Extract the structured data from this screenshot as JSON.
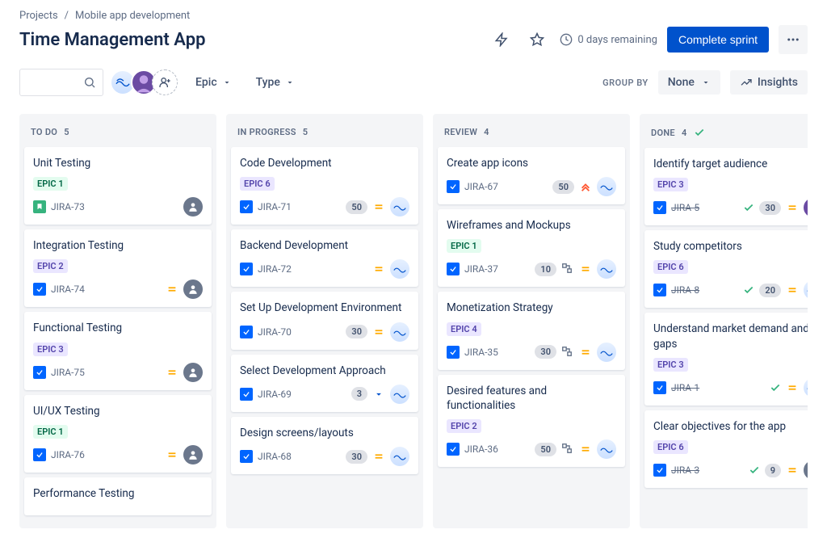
{
  "breadcrumb": {
    "projects": "Projects",
    "project": "Mobile app development"
  },
  "page_title": "Time Management App",
  "header": {
    "days_remaining": "0 days remaining",
    "complete_sprint": "Complete sprint"
  },
  "toolbar": {
    "epic_filter": "Epic",
    "type_filter": "Type",
    "group_by_label": "GROUP BY",
    "group_by_value": "None",
    "insights": "Insights"
  },
  "columns": [
    {
      "name": "TO DO",
      "count": "5"
    },
    {
      "name": "IN PROGRESS",
      "count": "5"
    },
    {
      "name": "REVIEW",
      "count": "4"
    },
    {
      "name": "DONE",
      "count": "4"
    }
  ],
  "cards": {
    "todo": [
      {
        "title": "Unit Testing",
        "epic": "EPIC 1",
        "epic_class": "epic-1",
        "key": "JIRA-73",
        "issue_type": "story",
        "est": null,
        "prio": null,
        "avatar": "grey"
      },
      {
        "title": "Integration Testing",
        "epic": "EPIC 2",
        "epic_class": "epic-2",
        "key": "JIRA-74",
        "issue_type": "task",
        "est": null,
        "prio": "medium",
        "avatar": "grey"
      },
      {
        "title": "Functional Testing",
        "epic": "EPIC 3",
        "epic_class": "epic-3",
        "key": "JIRA-75",
        "issue_type": "task",
        "est": null,
        "prio": "medium",
        "avatar": "grey"
      },
      {
        "title": "UI/UX Testing",
        "epic": "EPIC 1",
        "epic_class": "epic-1",
        "key": "JIRA-76",
        "issue_type": "task",
        "est": null,
        "prio": "medium",
        "avatar": "grey"
      },
      {
        "title": "Performance Testing",
        "epic": null,
        "key": "",
        "issue_type": "task"
      }
    ],
    "inprogress": [
      {
        "title": "Code Development",
        "epic": "EPIC 6",
        "epic_class": "epic-6",
        "key": "JIRA-71",
        "issue_type": "task",
        "est": "50",
        "prio": "medium",
        "avatar": "wave"
      },
      {
        "title": "Backend Development",
        "epic": null,
        "key": "JIRA-72",
        "issue_type": "task",
        "est": null,
        "prio": "medium",
        "avatar": "wave"
      },
      {
        "title": "Set Up Development Environment",
        "epic": null,
        "key": "JIRA-70",
        "issue_type": "task",
        "est": "30",
        "prio": "medium",
        "avatar": "wave"
      },
      {
        "title": "Select Development Approach",
        "epic": null,
        "key": "JIRA-69",
        "issue_type": "task",
        "est": "3",
        "prio_drop": true,
        "avatar": "wave"
      },
      {
        "title": "Design screens/layouts",
        "epic": null,
        "key": "JIRA-68",
        "issue_type": "task",
        "est": "30",
        "prio": "medium",
        "avatar": "wave"
      }
    ],
    "review": [
      {
        "title": "Create app icons",
        "epic": null,
        "key": "JIRA-67",
        "issue_type": "task",
        "est": "50",
        "prio": "highest",
        "avatar": "wave"
      },
      {
        "title": "Wireframes and Mockups",
        "epic": "EPIC 1",
        "epic_class": "epic-1",
        "key": "JIRA-37",
        "issue_type": "task",
        "est": "10",
        "link": true,
        "prio": "medium",
        "avatar": "wave"
      },
      {
        "title": "Monetization Strategy",
        "epic": "EPIC 4",
        "epic_class": "epic-4",
        "key": "JIRA-35",
        "issue_type": "task",
        "est": "30",
        "link": true,
        "prio": "medium",
        "avatar": "wave"
      },
      {
        "title": "Desired features and functionalities",
        "epic": "EPIC 2",
        "epic_class": "epic-2",
        "key": "JIRA-36",
        "issue_type": "task",
        "est": "50",
        "link": true,
        "prio": "medium",
        "avatar": "wave"
      }
    ],
    "done": [
      {
        "title": "Identify target audience",
        "epic": "EPIC 3",
        "epic_class": "epic-3",
        "key": "JIRA-5",
        "done": true,
        "issue_type": "task",
        "check": true,
        "est": "30",
        "prio": "medium",
        "avatar": "photo"
      },
      {
        "title": "Study competitors",
        "epic": "EPIC 6",
        "epic_class": "epic-6",
        "key": "JIRA-8",
        "done": true,
        "issue_type": "task",
        "check": true,
        "est": "20",
        "prio": "medium",
        "avatar": "wave"
      },
      {
        "title": "Understand market demand and gaps",
        "epic": "EPIC 3",
        "epic_class": "epic-3",
        "key": "JIRA-1",
        "done": true,
        "issue_type": "task",
        "check": true,
        "est": null,
        "prio": "medium",
        "avatar": "wave"
      },
      {
        "title": "Clear objectives for the app",
        "epic": "EPIC 6",
        "epic_class": "epic-6",
        "key": "JIRA-3",
        "done": true,
        "issue_type": "task",
        "check": true,
        "est": "9",
        "prio": "medium",
        "avatar": "grey"
      }
    ]
  }
}
